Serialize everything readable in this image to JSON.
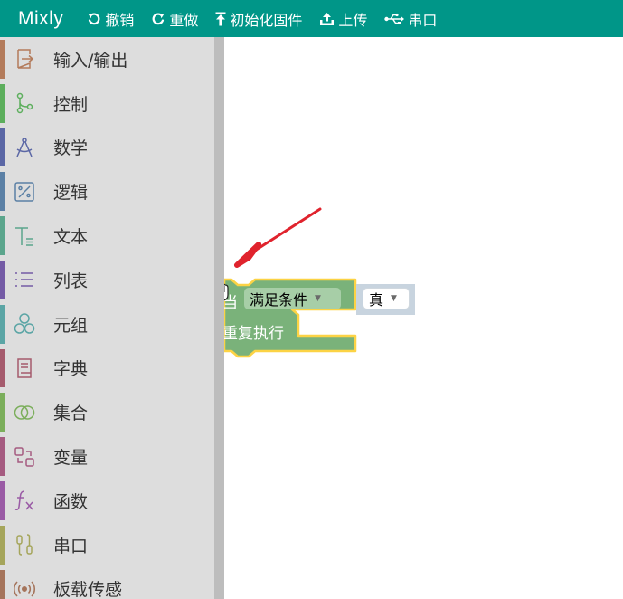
{
  "app": {
    "brand": "Mixly"
  },
  "toolbar": {
    "undo": "撤销",
    "redo": "重做",
    "init_firmware": "初始化固件",
    "upload": "上传",
    "serial": "串口"
  },
  "sidebar": {
    "items": [
      {
        "label": "输入/输出",
        "color": "#b37b5b"
      },
      {
        "label": "控制",
        "color": "#5cae5c"
      },
      {
        "label": "数学",
        "color": "#5b67a5"
      },
      {
        "label": "逻辑",
        "color": "#5b80a5"
      },
      {
        "label": "文本",
        "color": "#5ba58c"
      },
      {
        "label": "列表",
        "color": "#745ba5"
      },
      {
        "label": "元组",
        "color": "#5ba5a5"
      },
      {
        "label": "字典",
        "color": "#a55b6d"
      },
      {
        "label": "集合",
        "color": "#7bae5b"
      },
      {
        "label": "变量",
        "color": "#a55b80"
      },
      {
        "label": "函数",
        "color": "#9a5ba5"
      },
      {
        "label": "串口",
        "color": "#a5a55b"
      },
      {
        "label": "板载传感",
        "color": "#a5745b"
      }
    ]
  },
  "workspace": {
    "block": {
      "when_label": "当",
      "condition_dropdown": "满足条件",
      "value_dropdown": "真",
      "repeat_label": "重复执行",
      "block_color": "#7ab27a",
      "highlight_color": "#fcd345"
    }
  }
}
